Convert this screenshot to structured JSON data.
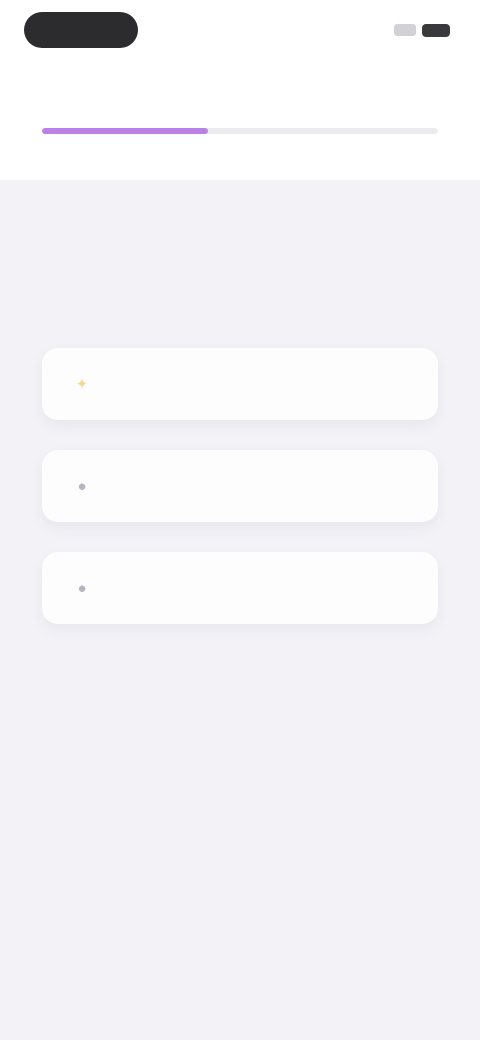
{
  "status_bar": {
    "icons": [
      "signal-icon",
      "battery-icon"
    ]
  },
  "nav": {
    "title": "",
    "action": ""
  },
  "progress": {
    "fraction": 0.42,
    "color": "#b981e6"
  },
  "question": {
    "text": ""
  },
  "options": [
    {
      "icon": "sparkle-icon",
      "label": ""
    },
    {
      "icon": "circle-icon",
      "label": ""
    },
    {
      "icon": "circle-icon",
      "label": ""
    }
  ],
  "colors": {
    "background": "#f2f2f7",
    "card": "#fdfdfe",
    "accent": "#b981e6"
  }
}
